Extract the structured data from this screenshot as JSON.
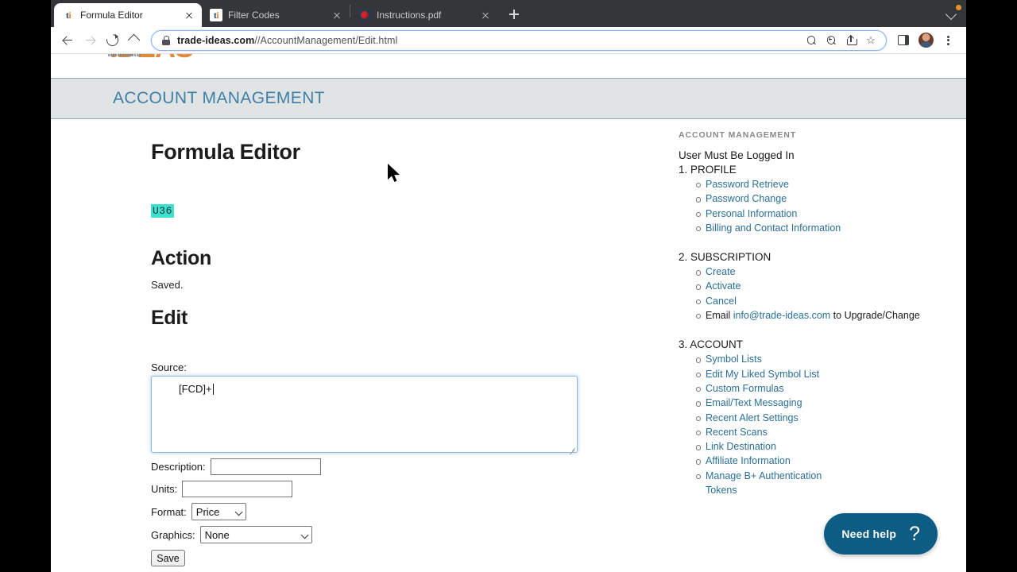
{
  "browser": {
    "tabs": [
      {
        "title": "Formula Editor",
        "favicon": "trade-ideas-icon",
        "active": true
      },
      {
        "title": "Filter Codes",
        "favicon": "trade-ideas-icon",
        "active": false
      },
      {
        "title": "Instructions.pdf",
        "favicon": "pdf-icon",
        "active": false
      }
    ],
    "new_tab_label": "+",
    "url_domain": "trade-ideas.com",
    "url_path": "//AccountManagement/Edit.html",
    "nav": {
      "back": "Back",
      "forward": "Forward",
      "reload": "Reload",
      "home": "Home"
    }
  },
  "site": {
    "logo_text": "IDEAS",
    "band_title": "ACCOUNT MANAGEMENT"
  },
  "main": {
    "page_title": "Formula Editor",
    "token": "U36",
    "action_heading": "Action",
    "action_status": "Saved.",
    "edit_heading": "Edit",
    "form": {
      "source_label": "Source:",
      "source_value": "[FCD]+",
      "description_label": "Description:",
      "description_value": "",
      "description_placeholder": "",
      "units_label": "Units:",
      "units_value": "",
      "units_placeholder": "",
      "format_label": "Format:",
      "format_value": "Price",
      "graphics_label": "Graphics:",
      "graphics_value": "None",
      "save_label": "Save"
    }
  },
  "sidebar": {
    "kicker": "ACCOUNT MANAGEMENT",
    "lead": "User Must Be Logged In",
    "sections": [
      {
        "heading": "1. PROFILE",
        "items": [
          {
            "label": "Password Retrieve",
            "type": "link"
          },
          {
            "label": "Password Change",
            "type": "link"
          },
          {
            "label": "Personal Information",
            "type": "link"
          },
          {
            "label": "Billing and Contact Information",
            "type": "link"
          }
        ]
      },
      {
        "heading": "2. SUBSCRIPTION",
        "items": [
          {
            "label": "Create",
            "type": "link"
          },
          {
            "label": "Activate",
            "type": "link"
          },
          {
            "label": "Cancel",
            "type": "link"
          },
          {
            "label": "Email info@trade-ideas.com to Upgrade/Change",
            "type": "mixed",
            "pre": "Email ",
            "link": "info@trade-ideas.com",
            "post": " to Upgrade/Change"
          }
        ]
      },
      {
        "heading": "3. ACCOUNT",
        "items": [
          {
            "label": "Symbol Lists",
            "type": "link"
          },
          {
            "label": "Edit My Liked Symbol List",
            "type": "link"
          },
          {
            "label": "Custom Formulas",
            "type": "link"
          },
          {
            "label": "Email/Text Messaging",
            "type": "link"
          },
          {
            "label": "Recent Alert Settings",
            "type": "link"
          },
          {
            "label": "Recent Scans",
            "type": "link"
          },
          {
            "label": "Link Destination",
            "type": "link"
          },
          {
            "label": "Affiliate Information",
            "type": "link"
          },
          {
            "label": "Manage B+ Authentication",
            "type": "link",
            "continuation": "Tokens"
          }
        ]
      }
    ]
  },
  "help_widget": {
    "label": "Need help",
    "icon": "question-mark-icon",
    "color": "#0d5c84"
  },
  "colors": {
    "band_bg": "#e0e4e5",
    "band_border": "#8fabc0",
    "band_text": "#3f7fa6",
    "link": "#2a6f97",
    "selection_highlight": "#40e0cf",
    "tabstrip_bg": "#35363a",
    "focus_border": "#8fb8df"
  }
}
